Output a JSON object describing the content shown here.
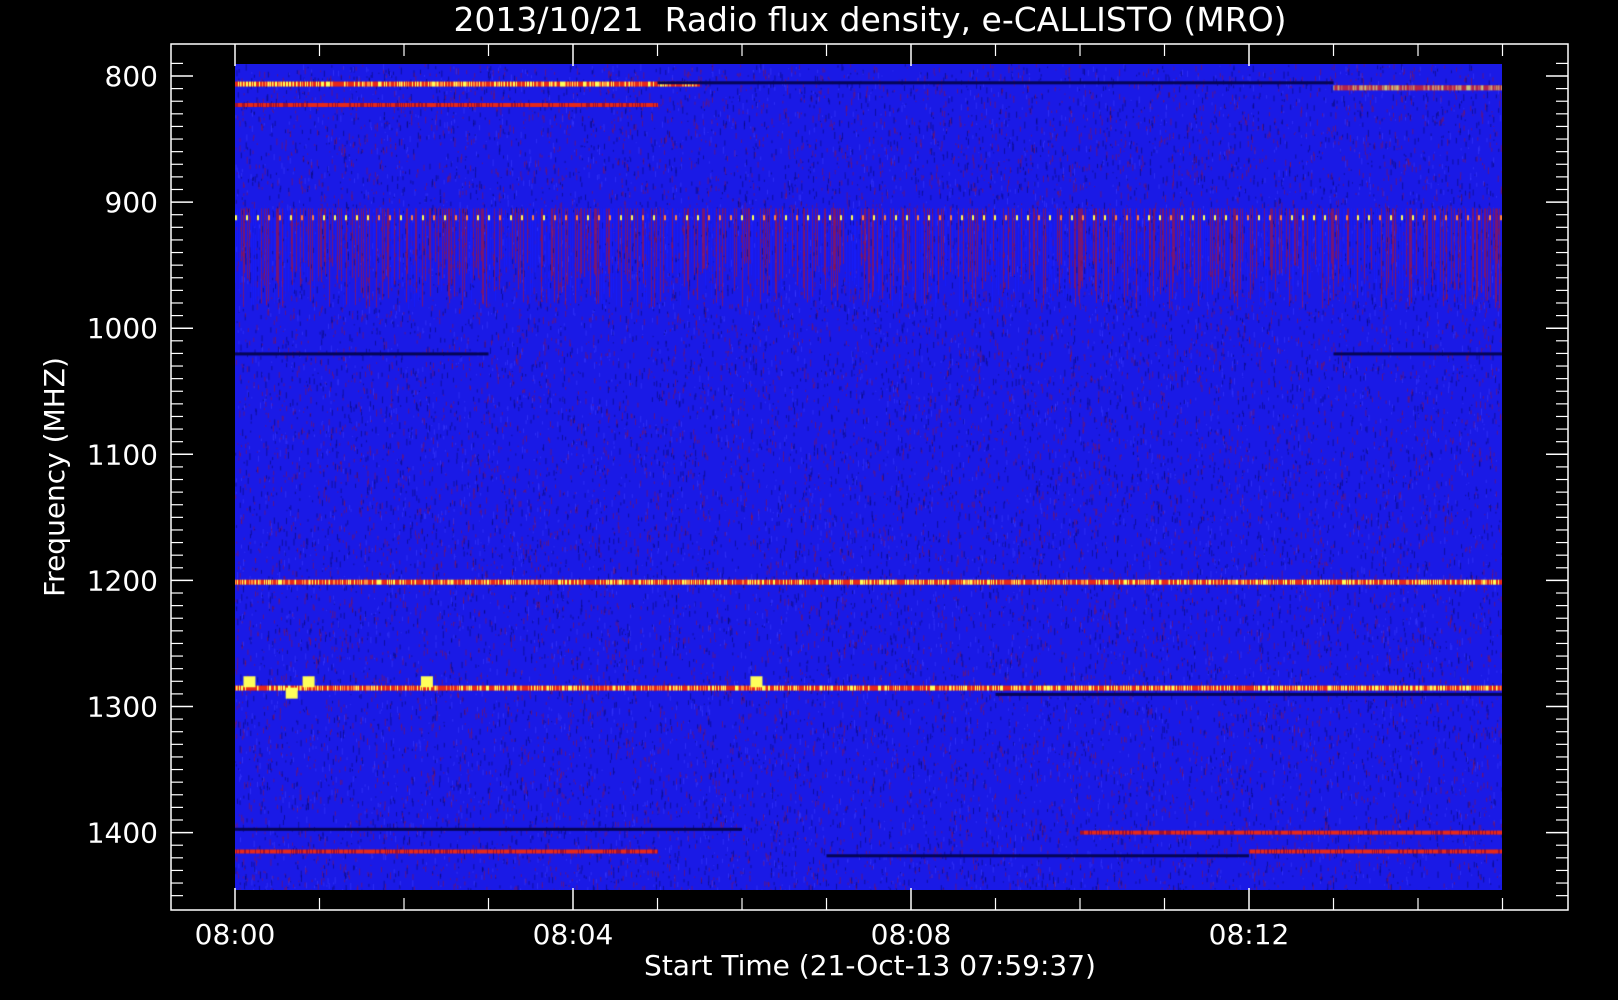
{
  "chart_data": {
    "type": "heatmap",
    "title": "2013/10/21  Radio flux density, e-CALLISTO (MRO)",
    "xlabel": "Start Time (21-Oct-13 07:59:37)",
    "ylabel": "Frequency (MHZ)",
    "x_range": [
      "07:59:37",
      "08:15:00"
    ],
    "y_range_mhz": [
      790,
      1450
    ],
    "y_axis_inverted": true,
    "x_ticks": [
      "08:00",
      "08:04",
      "08:08",
      "08:12"
    ],
    "y_ticks": [
      "800",
      "900",
      "1000",
      "1100",
      "1200",
      "1300",
      "1400"
    ],
    "y_tick_values": [
      800,
      900,
      1000,
      1100,
      1200,
      1300,
      1400
    ],
    "data_extent": {
      "t_start": "08:00",
      "t_end": "08:15",
      "f_top_mhz": 790,
      "f_bottom_mhz": 1450
    },
    "features": [
      {
        "freq_mhz": 806,
        "t_start": "08:00",
        "t_end": "08:05.5",
        "intensity": "high"
      },
      {
        "freq_mhz": 809,
        "t_start": "08:13",
        "t_end": "08:15",
        "intensity": "high"
      },
      {
        "freq_mhz": 823,
        "t_start": "08:00",
        "t_end": "08:05",
        "intensity": "medium"
      },
      {
        "freq_mhz": 912,
        "t_start": "08:00",
        "t_end": "08:15",
        "intensity": "dotted-high"
      },
      {
        "freq_mhz": 1201,
        "t_start": "08:00",
        "t_end": "08:15",
        "intensity": "high"
      },
      {
        "freq_mhz": 1285,
        "t_start": "08:00",
        "t_end": "08:15",
        "intensity": "high"
      },
      {
        "freq_mhz": 1400,
        "t_start": "08:10",
        "t_end": "08:15",
        "intensity": "medium"
      },
      {
        "freq_mhz": 1415,
        "t_start": "08:00",
        "t_end": "08:05",
        "intensity": "medium"
      },
      {
        "freq_mhz": 1415,
        "t_start": "08:12",
        "t_end": "08:15",
        "intensity": "medium"
      }
    ],
    "colors": {
      "background": "#000000",
      "base": "#1a1ae6",
      "low": "#050555",
      "mid": "#e6281a",
      "high": "#ffff5a"
    }
  }
}
